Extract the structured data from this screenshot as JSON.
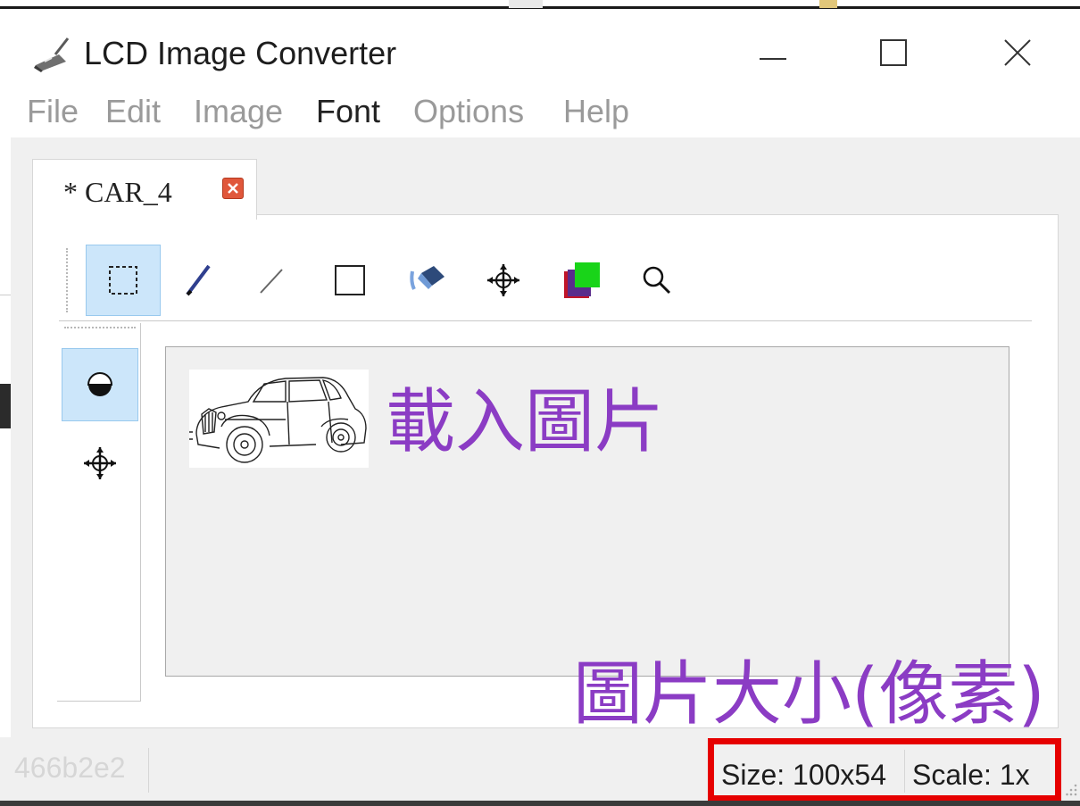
{
  "app": {
    "title": "LCD Image Converter"
  },
  "menu": {
    "file": "File",
    "edit": "Edit",
    "image": "Image",
    "font": "Font",
    "options": "Options",
    "help": "Help"
  },
  "tab": {
    "label": "* CAR_4"
  },
  "tools": [
    {
      "icon": "select-rect-icon"
    },
    {
      "icon": "pen-icon"
    },
    {
      "icon": "line-icon"
    },
    {
      "icon": "rectangle-icon"
    },
    {
      "icon": "fill-bucket-icon"
    },
    {
      "icon": "move-icon"
    },
    {
      "icon": "color-swap-icon"
    },
    {
      "icon": "zoom-icon"
    }
  ],
  "side_tools": [
    {
      "icon": "circle-brush-icon"
    },
    {
      "icon": "move-icon"
    }
  ],
  "annotations": {
    "load_image": "載入圖片",
    "image_size": "圖片大小(像素)"
  },
  "status": {
    "hash": "466b2e2",
    "size": "Size: 100x54",
    "scale": "Scale: 1x"
  },
  "colors": {
    "annotation": "#8b3cc4",
    "highlight": "#e60000",
    "selected_tool": "#cce6fa"
  }
}
